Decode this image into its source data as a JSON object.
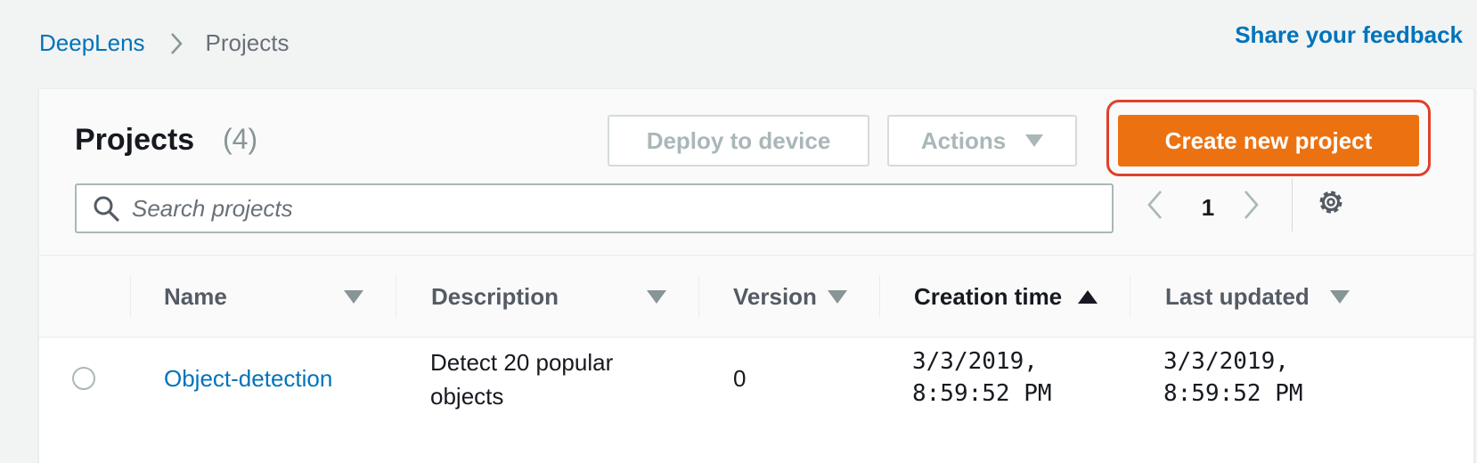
{
  "breadcrumb": {
    "root": "DeepLens",
    "current": "Projects"
  },
  "feedback_link": "Share your feedback",
  "panel": {
    "title": "Projects",
    "count": "(4)"
  },
  "toolbar": {
    "deploy_label": "Deploy to device",
    "actions_label": "Actions",
    "create_label": "Create new project"
  },
  "search": {
    "placeholder": "Search projects",
    "value": ""
  },
  "pagination": {
    "current_page": "1"
  },
  "table": {
    "columns": [
      {
        "label": "Name",
        "sort": "none"
      },
      {
        "label": "Description",
        "sort": "none"
      },
      {
        "label": "Version",
        "sort": "none"
      },
      {
        "label": "Creation time",
        "sort": "ascending"
      },
      {
        "label": "Last updated",
        "sort": "none"
      }
    ],
    "rows": [
      {
        "selected": false,
        "name": "Object-detection",
        "description_line1": "Detect 20 popular",
        "description_line2": "objects",
        "version": "0",
        "creation_date": "3/3/2019,",
        "creation_time": "8:59:52 PM",
        "updated_date": "3/3/2019,",
        "updated_time": "8:59:52 PM"
      }
    ]
  },
  "colors": {
    "link": "#0073bb",
    "primary_button": "#ec7211",
    "highlight_ring": "#e0402b",
    "background": "#f2f3f3"
  },
  "icons": [
    "chevron-right-icon",
    "caret-down-icon",
    "search-icon",
    "chevron-left-icon",
    "gear-icon",
    "sort-ascending-icon"
  ]
}
